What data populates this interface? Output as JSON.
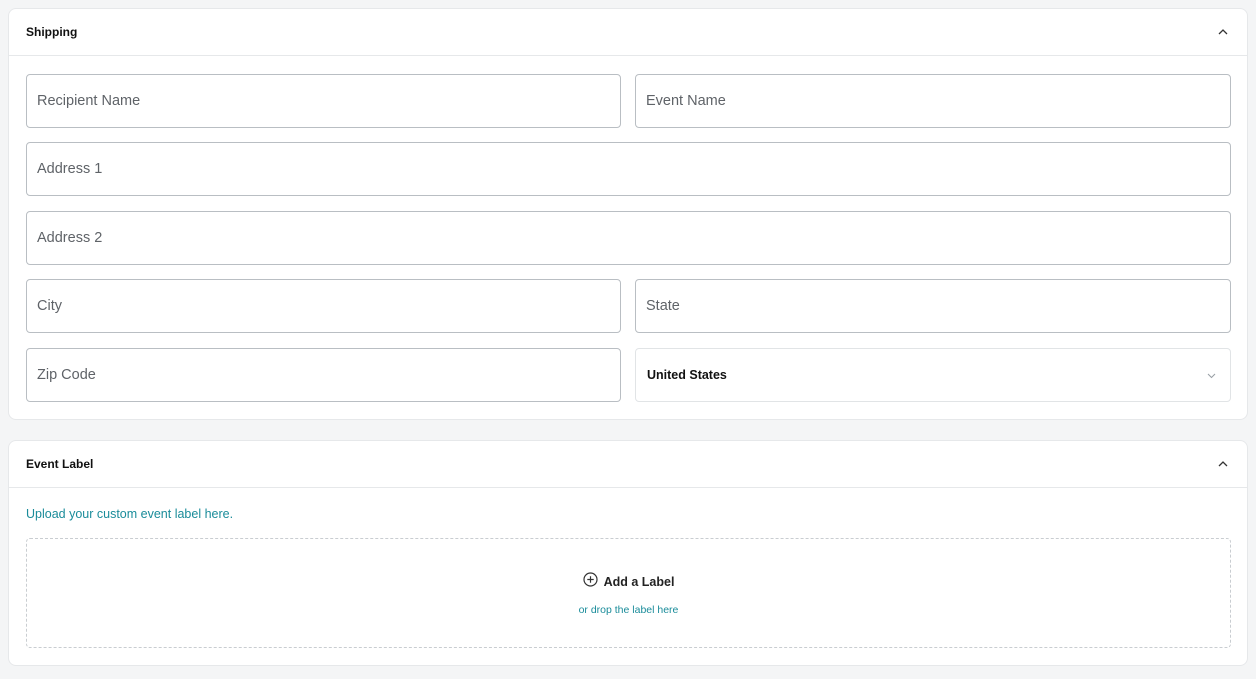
{
  "shipping": {
    "title": "Shipping",
    "fields": {
      "recipient_name": {
        "placeholder": "Recipient Name",
        "value": ""
      },
      "event_name": {
        "placeholder": "Event Name",
        "value": ""
      },
      "address1": {
        "placeholder": "Address 1",
        "value": ""
      },
      "address2": {
        "placeholder": "Address 2",
        "value": ""
      },
      "city": {
        "placeholder": "City",
        "value": ""
      },
      "state": {
        "placeholder": "State",
        "value": ""
      },
      "zip": {
        "placeholder": "Zip Code",
        "value": ""
      }
    },
    "country": {
      "selected": "United States"
    }
  },
  "event_label": {
    "title": "Event Label",
    "hint": "Upload your custom event label here.",
    "add_label": "Add a Label",
    "drop_text": "or drop the label here"
  },
  "icons": {
    "collapse": "chevron-up-icon",
    "dropdown": "chevron-down-icon",
    "add": "plus-circle-icon"
  },
  "colors": {
    "accent": "#1a8c9a",
    "border": "#b9bec3",
    "background": "#f4f5f6"
  }
}
